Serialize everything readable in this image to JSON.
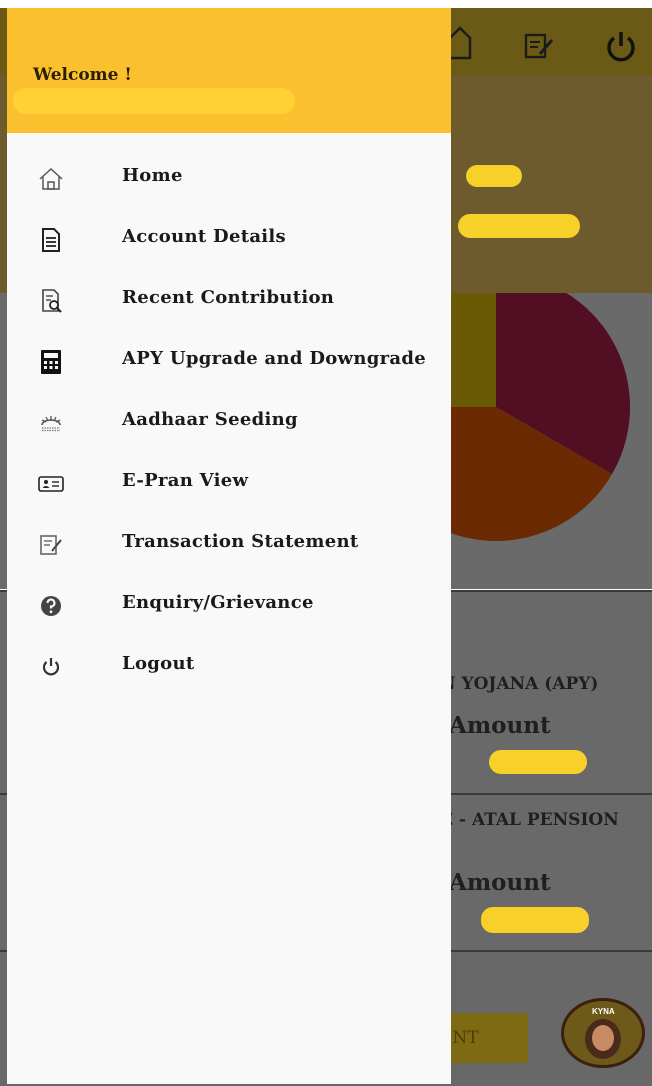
{
  "drawer": {
    "welcome": "Welcome !",
    "items": [
      {
        "label": "Home",
        "icon": "home-icon"
      },
      {
        "label": "Account Details",
        "icon": "document-icon"
      },
      {
        "label": "Recent Contribution",
        "icon": "document-search-icon"
      },
      {
        "label": "APY Upgrade and Downgrade",
        "icon": "calculator-icon"
      },
      {
        "label": "Aadhaar Seeding",
        "icon": "aadhaar-icon"
      },
      {
        "label": "E-Pran View",
        "icon": "id-card-icon"
      },
      {
        "label": "Transaction Statement",
        "icon": "edit-note-icon"
      },
      {
        "label": "Enquiry/Grievance",
        "icon": "help-icon"
      },
      {
        "label": "Logout",
        "icon": "power-icon"
      }
    ]
  },
  "background": {
    "scheme_apy": "N YOJANA (APY)",
    "scheme_atal": "E - ATAL PENSION",
    "amount_label": "Amount",
    "button_label": "ENT",
    "avatar_label": "KYNA",
    "pie_colors": [
      "#520f23",
      "#6b2a02",
      "#6b5a05"
    ]
  },
  "colors": {
    "accent": "#fbc02d",
    "redaction": "#f8d02a"
  }
}
